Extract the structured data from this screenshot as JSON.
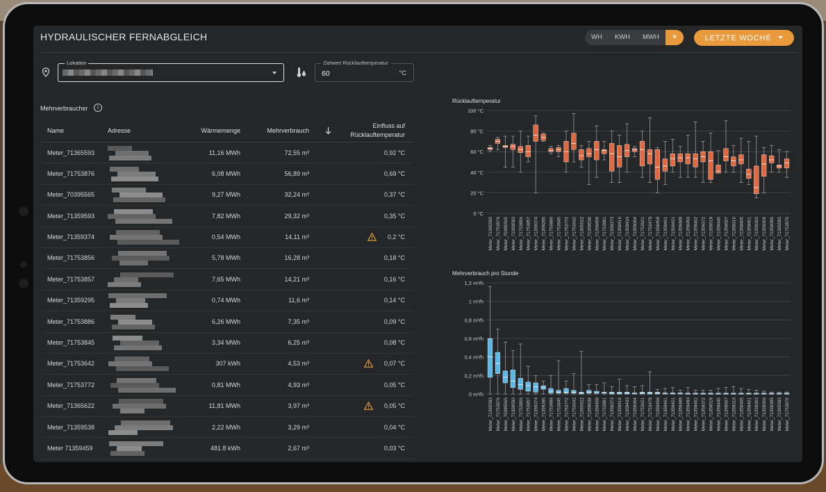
{
  "header": {
    "title": "HYDRAULISCHER FERNABGLEICH"
  },
  "unit_toggle": {
    "options": [
      "WH",
      "KWH",
      "MWH",
      "☀"
    ],
    "selected": "☀"
  },
  "period_button": {
    "label": "LETZTE WOCHE"
  },
  "location_field": {
    "label": "Lokation"
  },
  "target_field": {
    "label": "Zielwert Rücklauftemperatur",
    "value": "60",
    "unit": "°C"
  },
  "table": {
    "title": "Mehrverbraucher",
    "headers": {
      "name": "Name",
      "address": "Adresse",
      "heat": "Wärmemenge",
      "excess": "Mehrverbrauch",
      "influence_1": "Einfluss auf",
      "influence_2": "Rücklauftemperatur"
    },
    "rows": [
      {
        "name": "Meter_71365593",
        "heat": "11,16 MWh",
        "excess": "72,55 m³",
        "influence": "0,92 °C",
        "warn": false
      },
      {
        "name": "Meter_71753876",
        "heat": "6,08 MWh",
        "excess": "56,89 m³",
        "influence": "0,69 °C",
        "warn": false
      },
      {
        "name": "Meter_70395565",
        "heat": "9,27 MWh",
        "excess": "32,24 m³",
        "influence": "0,37 °C",
        "warn": false
      },
      {
        "name": "Meter_71359593",
        "heat": "7,82 MWh",
        "excess": "29,32 m³",
        "influence": "0,35 °C",
        "warn": false
      },
      {
        "name": "Meter_71359374",
        "heat": "0,54 MWh",
        "excess": "14,11 m³",
        "influence": "0,2 °C",
        "warn": true
      },
      {
        "name": "Meter_71753856",
        "heat": "5,78 MWh",
        "excess": "16,28 m³",
        "influence": "0,18 °C",
        "warn": false
      },
      {
        "name": "Meter_71753857",
        "heat": "7,65 MWh",
        "excess": "14,21 m³",
        "influence": "0,16 °C",
        "warn": false
      },
      {
        "name": "Meter_71359295",
        "heat": "0,74 MWh",
        "excess": "11,6 m³",
        "influence": "0,14 °C",
        "warn": false
      },
      {
        "name": "Meter_71753886",
        "heat": "6,26 MWh",
        "excess": "7,35 m³",
        "influence": "0,09 °C",
        "warn": false
      },
      {
        "name": "Meter_71753845",
        "heat": "3,34 MWh",
        "excess": "6,25 m³",
        "influence": "0,08 °C",
        "warn": false
      },
      {
        "name": "Meter_71753642",
        "heat": "307 kWh",
        "excess": "4,53 m³",
        "influence": "0,07 °C",
        "warn": true
      },
      {
        "name": "Meter_71753772",
        "heat": "0,81 MWh",
        "excess": "4,93 m³",
        "influence": "0,05 °C",
        "warn": false
      },
      {
        "name": "Meter_71365622",
        "heat": "11,81 MWh",
        "excess": "3,97 m³",
        "influence": "0,05 °C",
        "warn": true
      },
      {
        "name": "Meter_71359538",
        "heat": "2,22 MWh",
        "excess": "3,29 m³",
        "influence": "0,04 °C",
        "warn": false
      },
      {
        "name": "Meter 71359459",
        "heat": "481.8 kWh",
        "excess": "2,67 m³",
        "influence": "0,03 °C",
        "warn": false
      }
    ]
  },
  "colors": {
    "accent": "#e89a3c",
    "box_orange": "#e2693f",
    "box_blue": "#5bb8e6",
    "warning": "#e8a13c"
  },
  "chart_data": [
    {
      "type": "box",
      "title": "Rücklauftemperatur",
      "ylabel": "",
      "ylim": [
        0,
        100
      ],
      "ytick_labels": [
        "0 °C",
        "20 °C",
        "40 °C",
        "60 °C",
        "80 °C",
        "100 °C"
      ],
      "categories": [
        "Meter_71365593",
        "Meter_71753876",
        "Meter_70395565",
        "Meter_71359593",
        "Meter_71753856",
        "Meter_71753857",
        "Meter_71359374",
        "Meter_71359295",
        "Meter_71753886",
        "Meter_71753845",
        "Meter_71753772",
        "Meter_71753642",
        "Meter_71365622",
        "Meter_71359538",
        "Meter_71359459",
        "Meter_71753881",
        "Meter_71359373",
        "Meter_71359416",
        "Meter_71359433",
        "Meter_71359364",
        "Meter_71753621",
        "Meter_71753479",
        "Meter_71359458",
        "Meter_71359461",
        "Meter_71359421",
        "Meter_71359489",
        "Meter_71359493",
        "Meter_71359462",
        "Meter_71359372",
        "Meter_71359519",
        "Meter_71359446",
        "Meter_71359507",
        "Meter_71359310",
        "Meter_71359405",
        "Meter_71359401",
        "Meter_71359363",
        "Meter_71359306",
        "Meter_71359395"
      ],
      "boxes": [
        [
          60,
          62,
          63,
          64,
          66
        ],
        [
          62,
          68,
          70,
          72,
          74
        ],
        [
          45,
          64,
          65,
          66,
          75
        ],
        [
          45,
          62,
          65,
          67,
          75
        ],
        [
          40,
          59,
          62,
          65,
          80
        ],
        [
          50,
          55,
          60,
          66,
          75
        ],
        [
          20,
          70,
          76,
          86,
          95
        ],
        [
          70,
          71,
          74,
          77,
          78
        ],
        [
          58,
          60,
          61,
          63,
          65
        ],
        [
          55,
          60,
          62,
          64,
          66
        ],
        [
          40,
          50,
          60,
          70,
          80
        ],
        [
          50,
          62,
          68,
          78,
          97
        ],
        [
          45,
          52,
          56,
          62,
          66
        ],
        [
          28,
          55,
          58,
          63,
          70
        ],
        [
          35,
          52,
          62,
          70,
          85
        ],
        [
          52,
          58,
          61,
          62,
          70
        ],
        [
          30,
          41,
          58,
          68,
          80
        ],
        [
          30,
          45,
          55,
          66,
          76
        ],
        [
          40,
          55,
          61,
          67,
          87
        ],
        [
          55,
          60,
          62,
          63,
          65
        ],
        [
          35,
          46,
          62,
          70,
          80
        ],
        [
          30,
          48,
          58,
          62,
          93
        ],
        [
          20,
          33,
          45,
          62,
          64
        ],
        [
          28,
          41,
          46,
          53,
          70
        ],
        [
          40,
          46,
          53,
          58,
          72
        ],
        [
          35,
          50,
          54,
          58,
          65
        ],
        [
          35,
          48,
          54,
          58,
          76
        ],
        [
          35,
          45,
          53,
          58,
          89
        ],
        [
          30,
          50,
          55,
          60,
          70
        ],
        [
          30,
          33,
          51,
          60,
          78
        ],
        [
          40,
          39,
          41,
          47,
          61
        ],
        [
          40,
          51,
          55,
          63,
          90
        ],
        [
          40,
          46,
          51,
          55,
          66
        ],
        [
          30,
          48,
          52,
          57,
          73
        ],
        [
          28,
          34,
          38,
          43,
          70
        ],
        [
          15,
          19,
          25,
          46,
          75
        ],
        [
          20,
          36,
          48,
          57,
          64
        ],
        [
          40,
          49,
          52,
          56,
          66
        ],
        [
          40,
          44,
          46,
          47,
          62
        ],
        [
          35,
          44,
          49,
          53,
          60
        ]
      ]
    },
    {
      "type": "box",
      "title": "Mehrverbrauch pro Stunde",
      "ylabel": "",
      "ylim": [
        0,
        1.2
      ],
      "ytick_labels": [
        "0 m³/h",
        "0,2 m³/h",
        "0,4 m³/h",
        "0,6 m³/h",
        "0,8 m³/h",
        "1 m³/h",
        "1,2 m³/h"
      ],
      "categories": [
        "Meter_71365593",
        "Meter_71753876",
        "Meter_70395565",
        "Meter_71359593",
        "Meter_71753856",
        "Meter_71753857",
        "Meter_71359374",
        "Meter_71359295",
        "Meter_71753886",
        "Meter_71753845",
        "Meter_71753772",
        "Meter_71753642",
        "Meter_71365622",
        "Meter_71359538",
        "Meter_71359459",
        "Meter_71753881",
        "Meter_71359373",
        "Meter_71359416",
        "Meter_71359433",
        "Meter_71359364",
        "Meter_71753621",
        "Meter_71753479",
        "Meter_71359458",
        "Meter_71359461",
        "Meter_71359421",
        "Meter_71359489",
        "Meter_71359493",
        "Meter_71359462",
        "Meter_71359372",
        "Meter_71359519",
        "Meter_71359446",
        "Meter_71359507",
        "Meter_71359310",
        "Meter_71359405",
        "Meter_71359401",
        "Meter_71359363",
        "Meter_71359306",
        "Meter_71359395"
      ],
      "boxes": [
        [
          0,
          0.18,
          0.4,
          0.6,
          1.16
        ],
        [
          0,
          0.22,
          0.33,
          0.45,
          0.7
        ],
        [
          0,
          0.12,
          0.18,
          0.25,
          0.56
        ],
        [
          0,
          0.07,
          0.14,
          0.26,
          0.47
        ],
        [
          0,
          0.05,
          0.1,
          0.17,
          0.54
        ],
        [
          0,
          0.03,
          0.09,
          0.13,
          0.3
        ],
        [
          0,
          0.02,
          0.08,
          0.12,
          0.2
        ],
        [
          0,
          0.05,
          0.07,
          0.09,
          0.14
        ],
        [
          0,
          0.01,
          0.03,
          0.06,
          0.2
        ],
        [
          0,
          0.01,
          0.02,
          0.04,
          0.36
        ],
        [
          0,
          0.01,
          0.02,
          0.06,
          0.14
        ],
        [
          0,
          0.01,
          0.02,
          0.04,
          0.22
        ],
        [
          0,
          0,
          0.01,
          0.02,
          0.46
        ],
        [
          0,
          0.01,
          0.02,
          0.04,
          0.1
        ],
        [
          0,
          0.01,
          0.01,
          0.03,
          0.1
        ],
        [
          0,
          0.01,
          0.01,
          0.02,
          0.12
        ],
        [
          0,
          0,
          0.01,
          0.02,
          0.08
        ],
        [
          0,
          0,
          0.01,
          0.02,
          0.16
        ],
        [
          0,
          0,
          0.01,
          0.02,
          0.09
        ],
        [
          0,
          0,
          0.01,
          0.01,
          0.08
        ],
        [
          0,
          0,
          0.01,
          0.02,
          0.09
        ],
        [
          0,
          0,
          0.01,
          0.02,
          0.24
        ],
        [
          0,
          0,
          0.01,
          0.02,
          0.05
        ],
        [
          0,
          0,
          0.01,
          0.01,
          0.06
        ],
        [
          0,
          0,
          0.01,
          0.01,
          0.07
        ],
        [
          0,
          0,
          0.01,
          0.01,
          0.04
        ],
        [
          0,
          0,
          0,
          0.01,
          0.07
        ],
        [
          0,
          0,
          0,
          0.01,
          0.04
        ],
        [
          0,
          0,
          0,
          0.01,
          0.04
        ],
        [
          0,
          0,
          0,
          0.01,
          0.04
        ],
        [
          0,
          0,
          0,
          0.01,
          0.06
        ],
        [
          0,
          0,
          0,
          0.01,
          0.07
        ],
        [
          0,
          0,
          0,
          0.01,
          0.08
        ],
        [
          0,
          0,
          0,
          0.01,
          0.06
        ],
        [
          0,
          0,
          0,
          0.01,
          0.05
        ],
        [
          0,
          0,
          0,
          0.01,
          0.04
        ],
        [
          0,
          0,
          0,
          0.01,
          0.03
        ],
        [
          0,
          0,
          0,
          0.01,
          0.02
        ],
        [
          0,
          0,
          0,
          0.01,
          0.02
        ],
        [
          0,
          0,
          0,
          0.01,
          0.02
        ]
      ]
    }
  ]
}
